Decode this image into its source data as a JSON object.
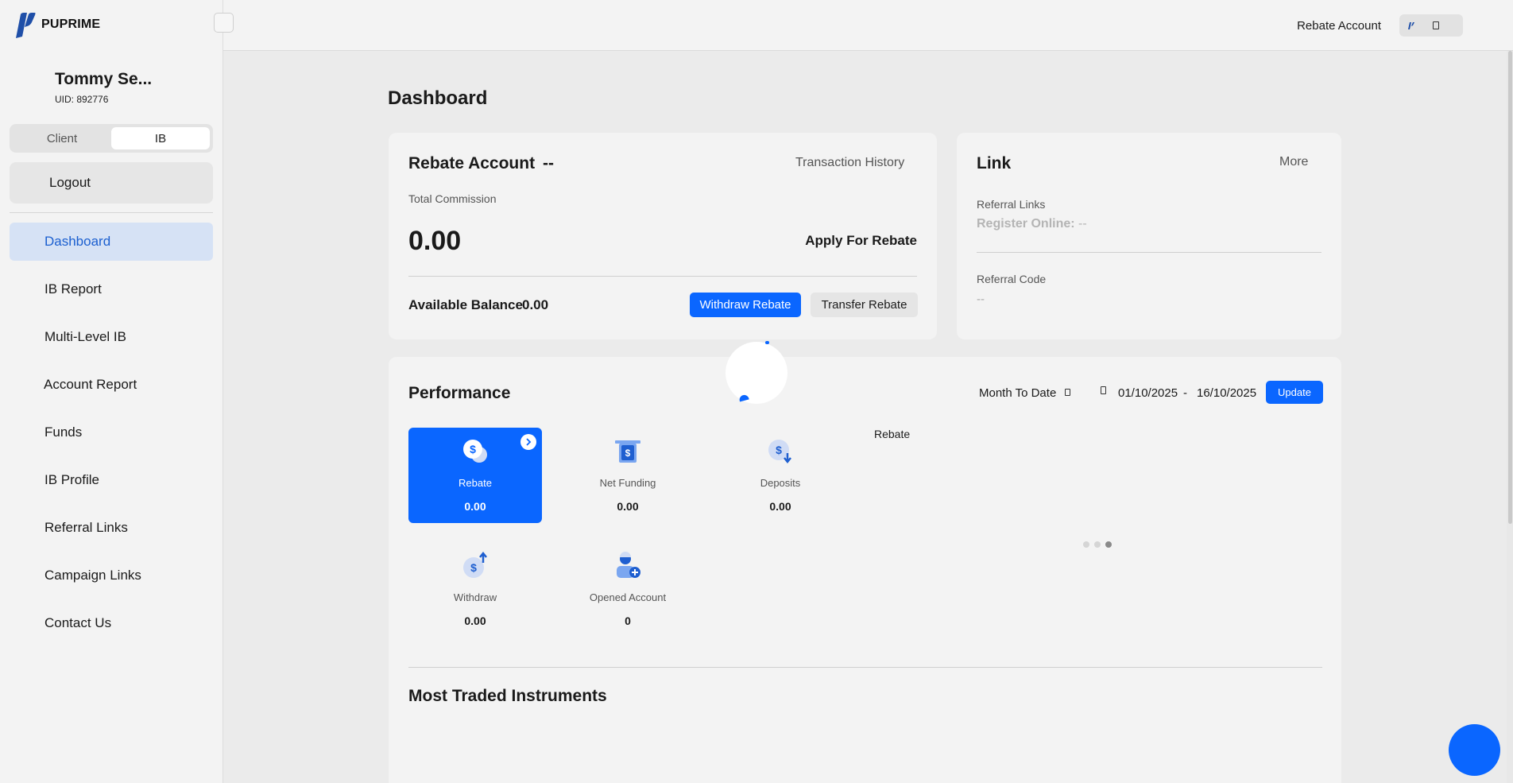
{
  "brand": {
    "name": "PUPRIME"
  },
  "user": {
    "name": "Tommy Se...",
    "uid": "UID: 892776"
  },
  "role_toggle": {
    "client": "Client",
    "ib": "IB",
    "active": "IB"
  },
  "sidebar": {
    "logout": "Logout",
    "items": [
      {
        "label": "Dashboard",
        "active": true
      },
      {
        "label": "IB Report"
      },
      {
        "label": "Multi-Level IB"
      },
      {
        "label": "Account Report"
      },
      {
        "label": "Funds"
      },
      {
        "label": "IB Profile"
      },
      {
        "label": "Referral Links"
      },
      {
        "label": "Campaign Links"
      },
      {
        "label": "Contact Us"
      }
    ]
  },
  "topbar": {
    "account_label": "Rebate Account"
  },
  "page": {
    "title": "Dashboard"
  },
  "rebate_card": {
    "title": "Rebate Account",
    "account_value": "--",
    "history_link": "Transaction History",
    "total_commission_label": "Total Commission",
    "total_commission": "0.00",
    "apply_label": "Apply For Rebate",
    "available_balance_label": "Available Balance",
    "available_balance": "0.00",
    "withdraw_label": "Withdraw Rebate",
    "transfer_label": "Transfer Rebate"
  },
  "link_card": {
    "title": "Link",
    "more_label": "More",
    "referral_links_label": "Referral Links",
    "register_online_label": "Register Online:",
    "register_online_value": "--",
    "referral_code_label": "Referral Code",
    "referral_code_value": "--"
  },
  "performance": {
    "title": "Performance",
    "period": "Month To Date",
    "date_from": "01/10/2025",
    "date_sep": "-",
    "date_to": "16/10/2025",
    "update_label": "Update",
    "metrics": [
      {
        "label": "Rebate",
        "value": "0.00",
        "icon": "dollar-coins-icon",
        "active": true
      },
      {
        "label": "Net Funding",
        "value": "0.00",
        "icon": "atm-dollar-icon"
      },
      {
        "label": "Deposits",
        "value": "0.00",
        "icon": "dollar-down-icon"
      },
      {
        "label": "Withdraw",
        "value": "0.00",
        "icon": "dollar-up-icon"
      },
      {
        "label": "Opened Account",
        "value": "0",
        "icon": "user-add-icon"
      }
    ],
    "chart_title": "Rebate",
    "carousel_active_index": 2,
    "most_traded_title": "Most Traded Instruments"
  },
  "colors": {
    "accent": "#0a66ff",
    "active_nav_bg": "#d6e2f5",
    "active_nav_text": "#1b5fd0"
  }
}
